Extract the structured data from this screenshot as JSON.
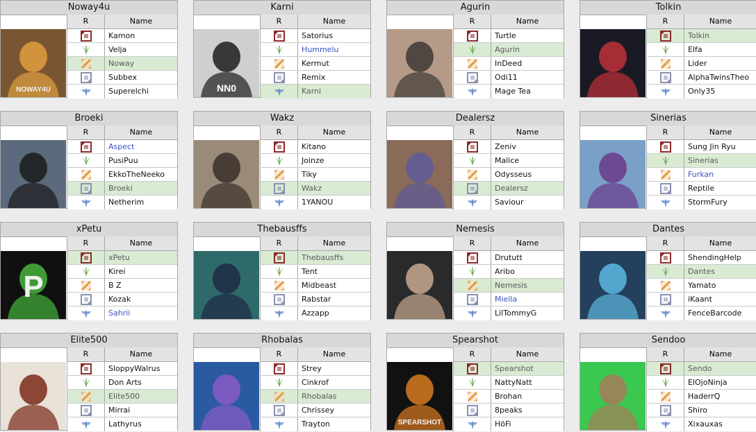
{
  "columns": {
    "role": "R",
    "name": "Name"
  },
  "roles": [
    "top",
    "jungle",
    "mid",
    "bot",
    "support"
  ],
  "teams": [
    {
      "title": "Noway4u",
      "photo_bg": "#7a5532",
      "photo_fg": "#e0a040",
      "photo_text": "NOWAY4U",
      "players": [
        {
          "name": "Kamon"
        },
        {
          "name": "Velja"
        },
        {
          "name": "Noway",
          "captain": true
        },
        {
          "name": "Subbex"
        },
        {
          "name": "Superelchi"
        }
      ]
    },
    {
      "title": "Karni",
      "photo_bg": "#cfcfcf",
      "photo_fg": "#1d1d1d",
      "photo_text": "NN0",
      "players": [
        {
          "name": "Satorius"
        },
        {
          "name": "Hummelu",
          "link": true
        },
        {
          "name": "Kermut"
        },
        {
          "name": "Remix"
        },
        {
          "name": "Karni",
          "captain": true
        }
      ]
    },
    {
      "title": "Agurin",
      "photo_bg": "#b59a88",
      "photo_fg": "#3d3a36",
      "photo_text": "",
      "players": [
        {
          "name": "Turtle"
        },
        {
          "name": "Agurin",
          "captain": true
        },
        {
          "name": "InDeed"
        },
        {
          "name": "Odi11"
        },
        {
          "name": "Mage Tea"
        }
      ]
    },
    {
      "title": "Tolkin",
      "photo_bg": "#1a1a24",
      "photo_fg": "#c0303a",
      "photo_text": "",
      "players": [
        {
          "name": "Tolkin",
          "captain": true
        },
        {
          "name": "Elfa"
        },
        {
          "name": "Lider"
        },
        {
          "name": "AlphaTwinsTheo"
        },
        {
          "name": "Only35"
        }
      ]
    },
    {
      "title": "Broeki",
      "photo_bg": "#5b6a7c",
      "photo_fg": "#1b1b1b",
      "photo_text": "",
      "players": [
        {
          "name": "Aspect",
          "link": true
        },
        {
          "name": "PusiPuu"
        },
        {
          "name": "EkkoTheNeeko"
        },
        {
          "name": "Broeki",
          "captain": true
        },
        {
          "name": "Netherim"
        }
      ]
    },
    {
      "title": "Wakz",
      "photo_bg": "#9a8a78",
      "photo_fg": "#3a2f28",
      "photo_text": "",
      "players": [
        {
          "name": "Kitano"
        },
        {
          "name": "Joinze"
        },
        {
          "name": "Tiky"
        },
        {
          "name": "Wakz",
          "captain": true
        },
        {
          "name": "1YANOU"
        }
      ]
    },
    {
      "title": "Dealersz",
      "photo_bg": "#8a6a58",
      "photo_fg": "#5d5a9a",
      "photo_text": "",
      "players": [
        {
          "name": "Zeniv"
        },
        {
          "name": "Malice"
        },
        {
          "name": "Odysseus"
        },
        {
          "name": "Dealersz",
          "captain": true
        },
        {
          "name": "Saviour"
        }
      ]
    },
    {
      "title": "Sinerias",
      "photo_bg": "#7aa0c8",
      "photo_fg": "#6a3a8a",
      "photo_text": "",
      "players": [
        {
          "name": "Sung Jin Ryu"
        },
        {
          "name": "Sinerias",
          "captain": true
        },
        {
          "name": "Furkan",
          "link": true
        },
        {
          "name": "Reptile"
        },
        {
          "name": "StormFury"
        }
      ]
    },
    {
      "title": "xPetu",
      "photo_bg": "#101010",
      "photo_fg": "#46b43c",
      "photo_text": "P",
      "players": [
        {
          "name": "xPetu",
          "captain": true
        },
        {
          "name": "Kirei"
        },
        {
          "name": "B Z"
        },
        {
          "name": "Kozak"
        },
        {
          "name": "Sahrii",
          "link": true
        }
      ]
    },
    {
      "title": "Thebausffs",
      "photo_bg": "#2e6a6a",
      "photo_fg": "#1f2a44",
      "photo_text": "",
      "players": [
        {
          "name": "Thebausffs",
          "captain": true
        },
        {
          "name": "Tent"
        },
        {
          "name": "Midbeast"
        },
        {
          "name": "Rabstar"
        },
        {
          "name": "Azzapp"
        }
      ]
    },
    {
      "title": "Nemesis",
      "photo_bg": "#2a2a2a",
      "photo_fg": "#c8a890",
      "photo_text": "",
      "players": [
        {
          "name": "Drututt"
        },
        {
          "name": "Aribo"
        },
        {
          "name": "Nemesis",
          "captain": true
        },
        {
          "name": "Miella",
          "link": true
        },
        {
          "name": "LilTommyG"
        }
      ]
    },
    {
      "title": "Dantes",
      "photo_bg": "#24405c",
      "photo_fg": "#5cb8e0",
      "photo_text": "",
      "players": [
        {
          "name": "ShendingHelp"
        },
        {
          "name": "Dantes",
          "captain": true
        },
        {
          "name": "Yamato"
        },
        {
          "name": "iKaant"
        },
        {
          "name": "FenceBarcode"
        }
      ]
    },
    {
      "title": "Elite500",
      "photo_bg": "#e8e2d8",
      "photo_fg": "#7a2a1a",
      "photo_text": "",
      "players": [
        {
          "name": "SloppyWalrus"
        },
        {
          "name": "Don Arts"
        },
        {
          "name": "Elite500",
          "captain": true
        },
        {
          "name": "Mirrai"
        },
        {
          "name": "Lathyrus"
        }
      ]
    },
    {
      "title": "Rhobalas",
      "photo_bg": "#2a5aa0",
      "photo_fg": "#8a5ac8",
      "photo_text": "",
      "players": [
        {
          "name": "Strey"
        },
        {
          "name": "Cinkrof"
        },
        {
          "name": "Rhobalas",
          "captain": true
        },
        {
          "name": "Chrissey"
        },
        {
          "name": "Trayton"
        }
      ]
    },
    {
      "title": "Spearshot",
      "photo_bg": "#111111",
      "photo_fg": "#d87a20",
      "photo_text": "SPEARSHOT",
      "players": [
        {
          "name": "Spearshot",
          "captain": true
        },
        {
          "name": "NattyNatt"
        },
        {
          "name": "Brohan"
        },
        {
          "name": "8peaks"
        },
        {
          "name": "HöFi"
        }
      ]
    },
    {
      "title": "Sendoo",
      "photo_bg": "#3ac850",
      "photo_fg": "#a87a58",
      "photo_text": "",
      "players": [
        {
          "name": "Sendo",
          "captain": true
        },
        {
          "name": "ElOjoNinja"
        },
        {
          "name": "HaderrQ"
        },
        {
          "name": "Shiro"
        },
        {
          "name": "Xixauxas"
        }
      ]
    }
  ],
  "colors": {
    "captain_row": "#d9ebd3",
    "link": "#3a52c5",
    "header": "#d8d8d8",
    "top_icon": "#8b2a2a",
    "jungle_icon": "#6aa84f",
    "mid_icon": "#e59a3c",
    "bot_icon": "#8a8fb0",
    "support_icon": "#6d8fcf"
  }
}
